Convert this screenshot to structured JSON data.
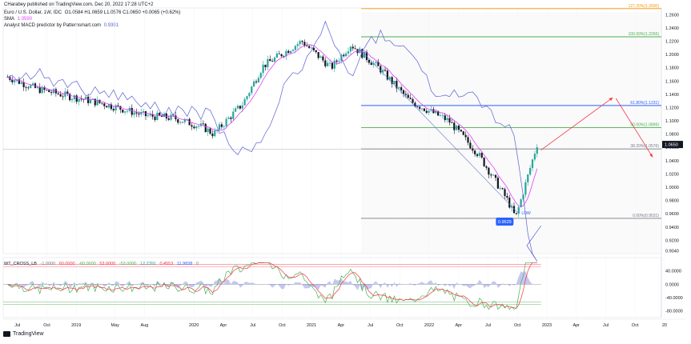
{
  "header": {
    "attribution": "CHarabey published on TradingView.com, Dec 20, 2022 17:28 UTC+2",
    "symbol": "Euro / U.S. Dollar, 1W, IDC",
    "ohlc": "O1.0584  H1.0659  L1.0576  C1.0650  +0.0065 (+0.62%)",
    "sma_label": "SMA",
    "sma_value": "1.0590",
    "macd_label": "Analyst MACD predictor by Patternsmart.com",
    "macd_value": "0.9391"
  },
  "oscillator_header": {
    "name": "WT_CROSS_LB",
    "values": [
      "-1.0000",
      "60.0000",
      "-60.0000",
      "53.0000",
      "-53.0000",
      "12.2391",
      "0.4553",
      "11.9838",
      "0"
    ]
  },
  "footer": {
    "brand": "TradingView"
  },
  "colors": {
    "candle_up": "#26a69a",
    "candle_down": "#131722",
    "sma": "#e040fb",
    "predictor": "#5b5fd6",
    "fib_orange": "#ff9800",
    "fib_green": "#4caf50",
    "fib_blue": "#2962ff",
    "fib_grey": "#787b86",
    "arrow": "#f23645",
    "low_label": "#2962ff"
  },
  "chart_data": [
    {
      "type": "candlestick",
      "title": "Euro / U.S. Dollar, 1W, IDC",
      "y_axis_ticks": [
        "1.2600",
        "1.2400",
        "1.2200",
        "1.2000",
        "1.1800",
        "1.1600",
        "1.1400",
        "1.1200",
        "1.1000",
        "1.0800",
        "1.0600",
        "1.0400",
        "1.0200",
        "1.0000",
        "0.9800",
        "0.9600",
        "0.9400",
        "0.9200",
        "0.9040"
      ],
      "ylim": [
        0.9,
        1.27
      ],
      "x_axis_ticks": [
        "Jul",
        "Oct",
        "2019",
        "May",
        "Aug",
        "2020",
        "Apr",
        "Jul",
        "Oct",
        "2021",
        "Apr",
        "Jul",
        "Oct",
        "2022",
        "Apr",
        "Jul",
        "Oct",
        "2023",
        "Apr",
        "Jul",
        "Oct",
        "20"
      ],
      "price_path": [
        [
          "2018-06",
          1.166
        ],
        [
          "2018-09",
          1.148
        ],
        [
          "2018-12",
          1.138
        ],
        [
          "2019-04",
          1.125
        ],
        [
          "2019-08",
          1.108
        ],
        [
          "2019-11",
          1.104
        ],
        [
          "2020-02",
          1.09
        ],
        [
          "2020-03",
          1.08
        ],
        [
          "2020-06",
          1.126
        ],
        [
          "2020-08",
          1.182
        ],
        [
          "2020-12",
          1.22
        ],
        [
          "2021-03",
          1.18
        ],
        [
          "2021-05",
          1.215
        ],
        [
          "2021-08",
          1.178
        ],
        [
          "2021-11",
          1.13
        ],
        [
          "2022-03",
          1.1
        ],
        [
          "2022-06",
          1.05
        ],
        [
          "2022-09",
          0.98
        ],
        [
          "2022-09-26",
          0.9536
        ],
        [
          "2022-12",
          1.065
        ]
      ],
      "sma_last": 1.059,
      "last_price": "1.0650",
      "fib_levels": [
        {
          "label": "127.20%(1.2690)",
          "value": 1.269,
          "color": "#ff9800"
        },
        {
          "label": "100.00%(1.2266)",
          "value": 1.2266,
          "color": "#4caf50"
        },
        {
          "label": "61.80%(1.1231)",
          "value": 1.1231,
          "color": "#2962ff"
        },
        {
          "label": "50.00%(1.0899)",
          "value": 1.0899,
          "color": "#4caf50"
        },
        {
          "label": "38.20%(1.0576)",
          "value": 1.0576,
          "color": "#787b86"
        },
        {
          "label": "0.00%(0.9531)",
          "value": 0.9531,
          "color": "#787b86"
        }
      ],
      "low_annotation": "0.9529",
      "low_marker_text": "LOW"
    },
    {
      "type": "line",
      "name": "WT_CROSS_LB",
      "y_axis_ticks": [
        "40.0000",
        "0.0000",
        "-40.0000",
        "-80.0000"
      ],
      "ylim": [
        -100,
        80
      ],
      "levels": [
        60,
        53,
        -53,
        -60
      ]
    }
  ]
}
